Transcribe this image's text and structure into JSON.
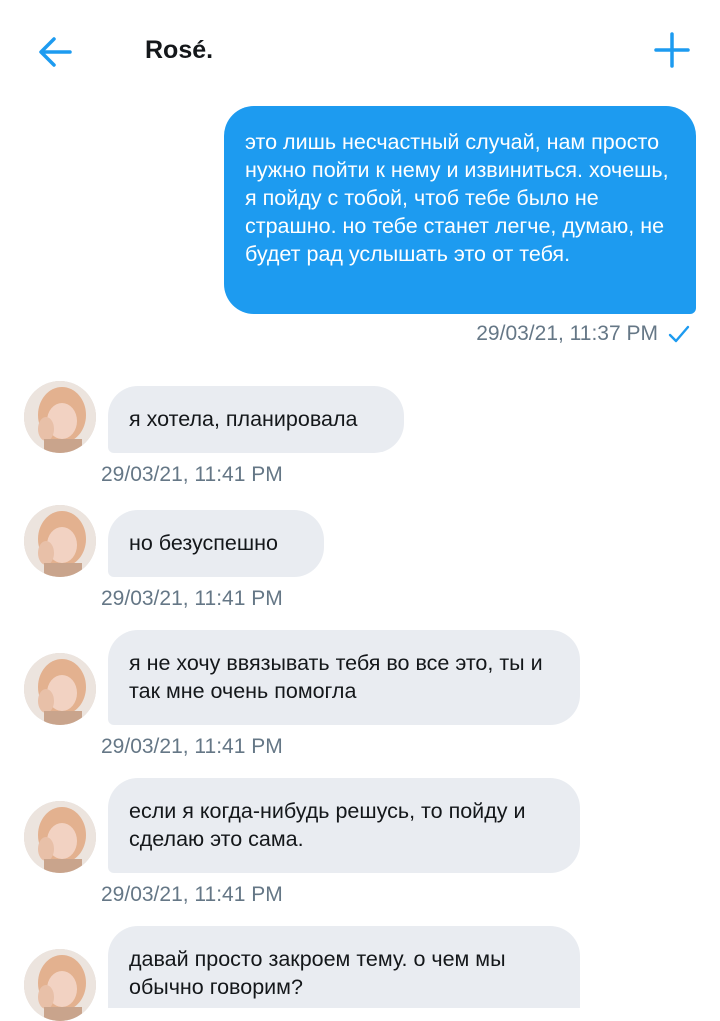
{
  "header": {
    "title": "Rosé."
  },
  "outgoing": {
    "text": "это лишь несчастный случай, нам просто нужно пойти к нему и извиниться. хочешь, я пойду с тобой, чтоб тебе было не страшно. но тебе станет легче, думаю, не будет рад услышать это от тебя.",
    "timestamp": "29/03/21, 11:37 PM",
    "status_icon": "checkmark-icon"
  },
  "messages": [
    {
      "text": "я хотела, планировала",
      "timestamp": "29/03/21, 11:41 PM"
    },
    {
      "text": "но безуспешно",
      "timestamp": "29/03/21, 11:41 PM"
    },
    {
      "text": "я не хочу ввязывать тебя во все это, ты и так мне очень помогла",
      "timestamp": "29/03/21, 11:41 PM"
    },
    {
      "text": "если я когда-нибудь решусь, то пойду и сделаю это сама.",
      "timestamp": "29/03/21, 11:41 PM"
    },
    {
      "text": "давай просто закроем тему. о чем мы обычно говорим?",
      "timestamp": ""
    }
  ],
  "colors": {
    "accent": "#1d9bf0",
    "incoming_bubble": "#e9ecf1",
    "meta_text": "#657786"
  }
}
